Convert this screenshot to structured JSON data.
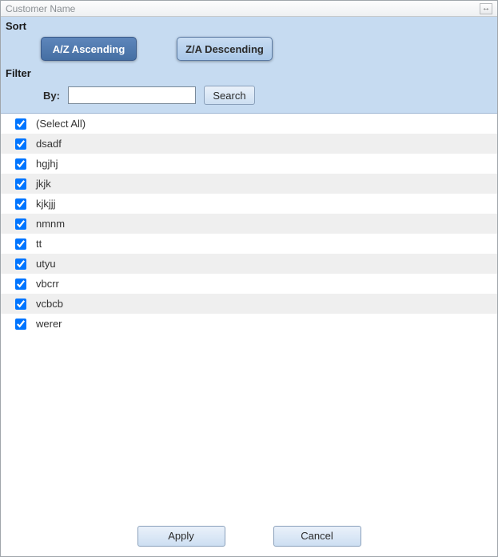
{
  "title": "Customer Name",
  "sort": {
    "label": "Sort",
    "asc_label": "A/Z Ascending",
    "desc_label": "Z/A Descending"
  },
  "filter": {
    "label": "Filter",
    "by_label": "By:",
    "input_value": "",
    "search_label": "Search"
  },
  "items": [
    {
      "label": "(Select All)",
      "checked": true
    },
    {
      "label": "dsadf",
      "checked": true
    },
    {
      "label": "hgjhj",
      "checked": true
    },
    {
      "label": "jkjk",
      "checked": true
    },
    {
      "label": "kjkjjj",
      "checked": true
    },
    {
      "label": "nmnm",
      "checked": true
    },
    {
      "label": "tt",
      "checked": true
    },
    {
      "label": "utyu",
      "checked": true
    },
    {
      "label": "vbcrr",
      "checked": true
    },
    {
      "label": "vcbcb",
      "checked": true
    },
    {
      "label": "werer",
      "checked": true
    }
  ],
  "footer": {
    "apply_label": "Apply",
    "cancel_label": "Cancel"
  }
}
